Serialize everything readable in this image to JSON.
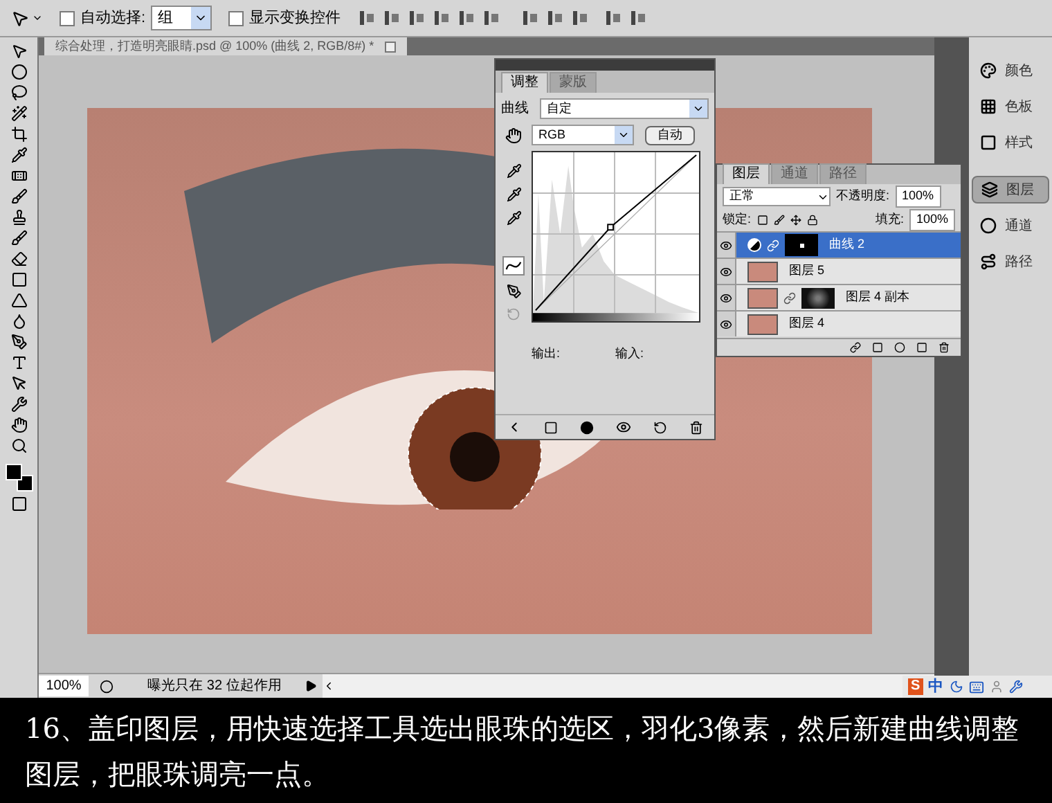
{
  "options_bar": {
    "auto_select": {
      "label": "自动选择:",
      "checked": false
    },
    "auto_select_target": "组",
    "show_transform": {
      "label": "显示变换控件",
      "checked": false
    }
  },
  "document": {
    "tab_title": "综合处理，打造明亮眼睛.psd @ 100% (曲线 2, RGB/8#) *"
  },
  "adjustments_panel": {
    "tabs": [
      {
        "label": "调整",
        "selected": true
      },
      {
        "label": "蒙版",
        "selected": false
      }
    ],
    "title": "曲线",
    "preset": "自定",
    "channel": "RGB",
    "auto_button": "自动",
    "output_label": "输出:",
    "input_label": "输入:"
  },
  "layers_panel": {
    "tabs": [
      {
        "label": "图层",
        "selected": true
      },
      {
        "label": "通道",
        "selected": false
      },
      {
        "label": "路径",
        "selected": false
      }
    ],
    "blend_mode": "正常",
    "opacity_label": "不透明度:",
    "opacity": "100%",
    "lock_label": "锁定:",
    "fill_label": "填充:",
    "fill": "100%",
    "layers": [
      {
        "name": "曲线 2",
        "kind": "adjustment",
        "selected": true,
        "visible": true
      },
      {
        "name": "图层 5",
        "kind": "image",
        "selected": false,
        "visible": true
      },
      {
        "name": "图层 4 副本",
        "kind": "masked",
        "selected": false,
        "visible": true
      },
      {
        "name": "图层 4",
        "kind": "image",
        "selected": false,
        "visible": true
      }
    ]
  },
  "dock": {
    "items": [
      {
        "label": "颜色",
        "selected": false
      },
      {
        "label": "色板",
        "selected": false
      },
      {
        "label": "样式",
        "selected": false
      },
      {
        "label": "图层",
        "selected": true
      },
      {
        "label": "通道",
        "selected": false
      },
      {
        "label": "路径",
        "selected": false
      }
    ]
  },
  "status_bar": {
    "zoom": "100%",
    "info": "曝光只在 32 位起作用"
  },
  "tray": {
    "logo": "S",
    "ime": "中"
  },
  "caption": "16、盖印图层，用快速选择工具选出眼珠的选区，羽化3像素，然后新建曲线调整图层，把眼珠调亮一点。"
}
